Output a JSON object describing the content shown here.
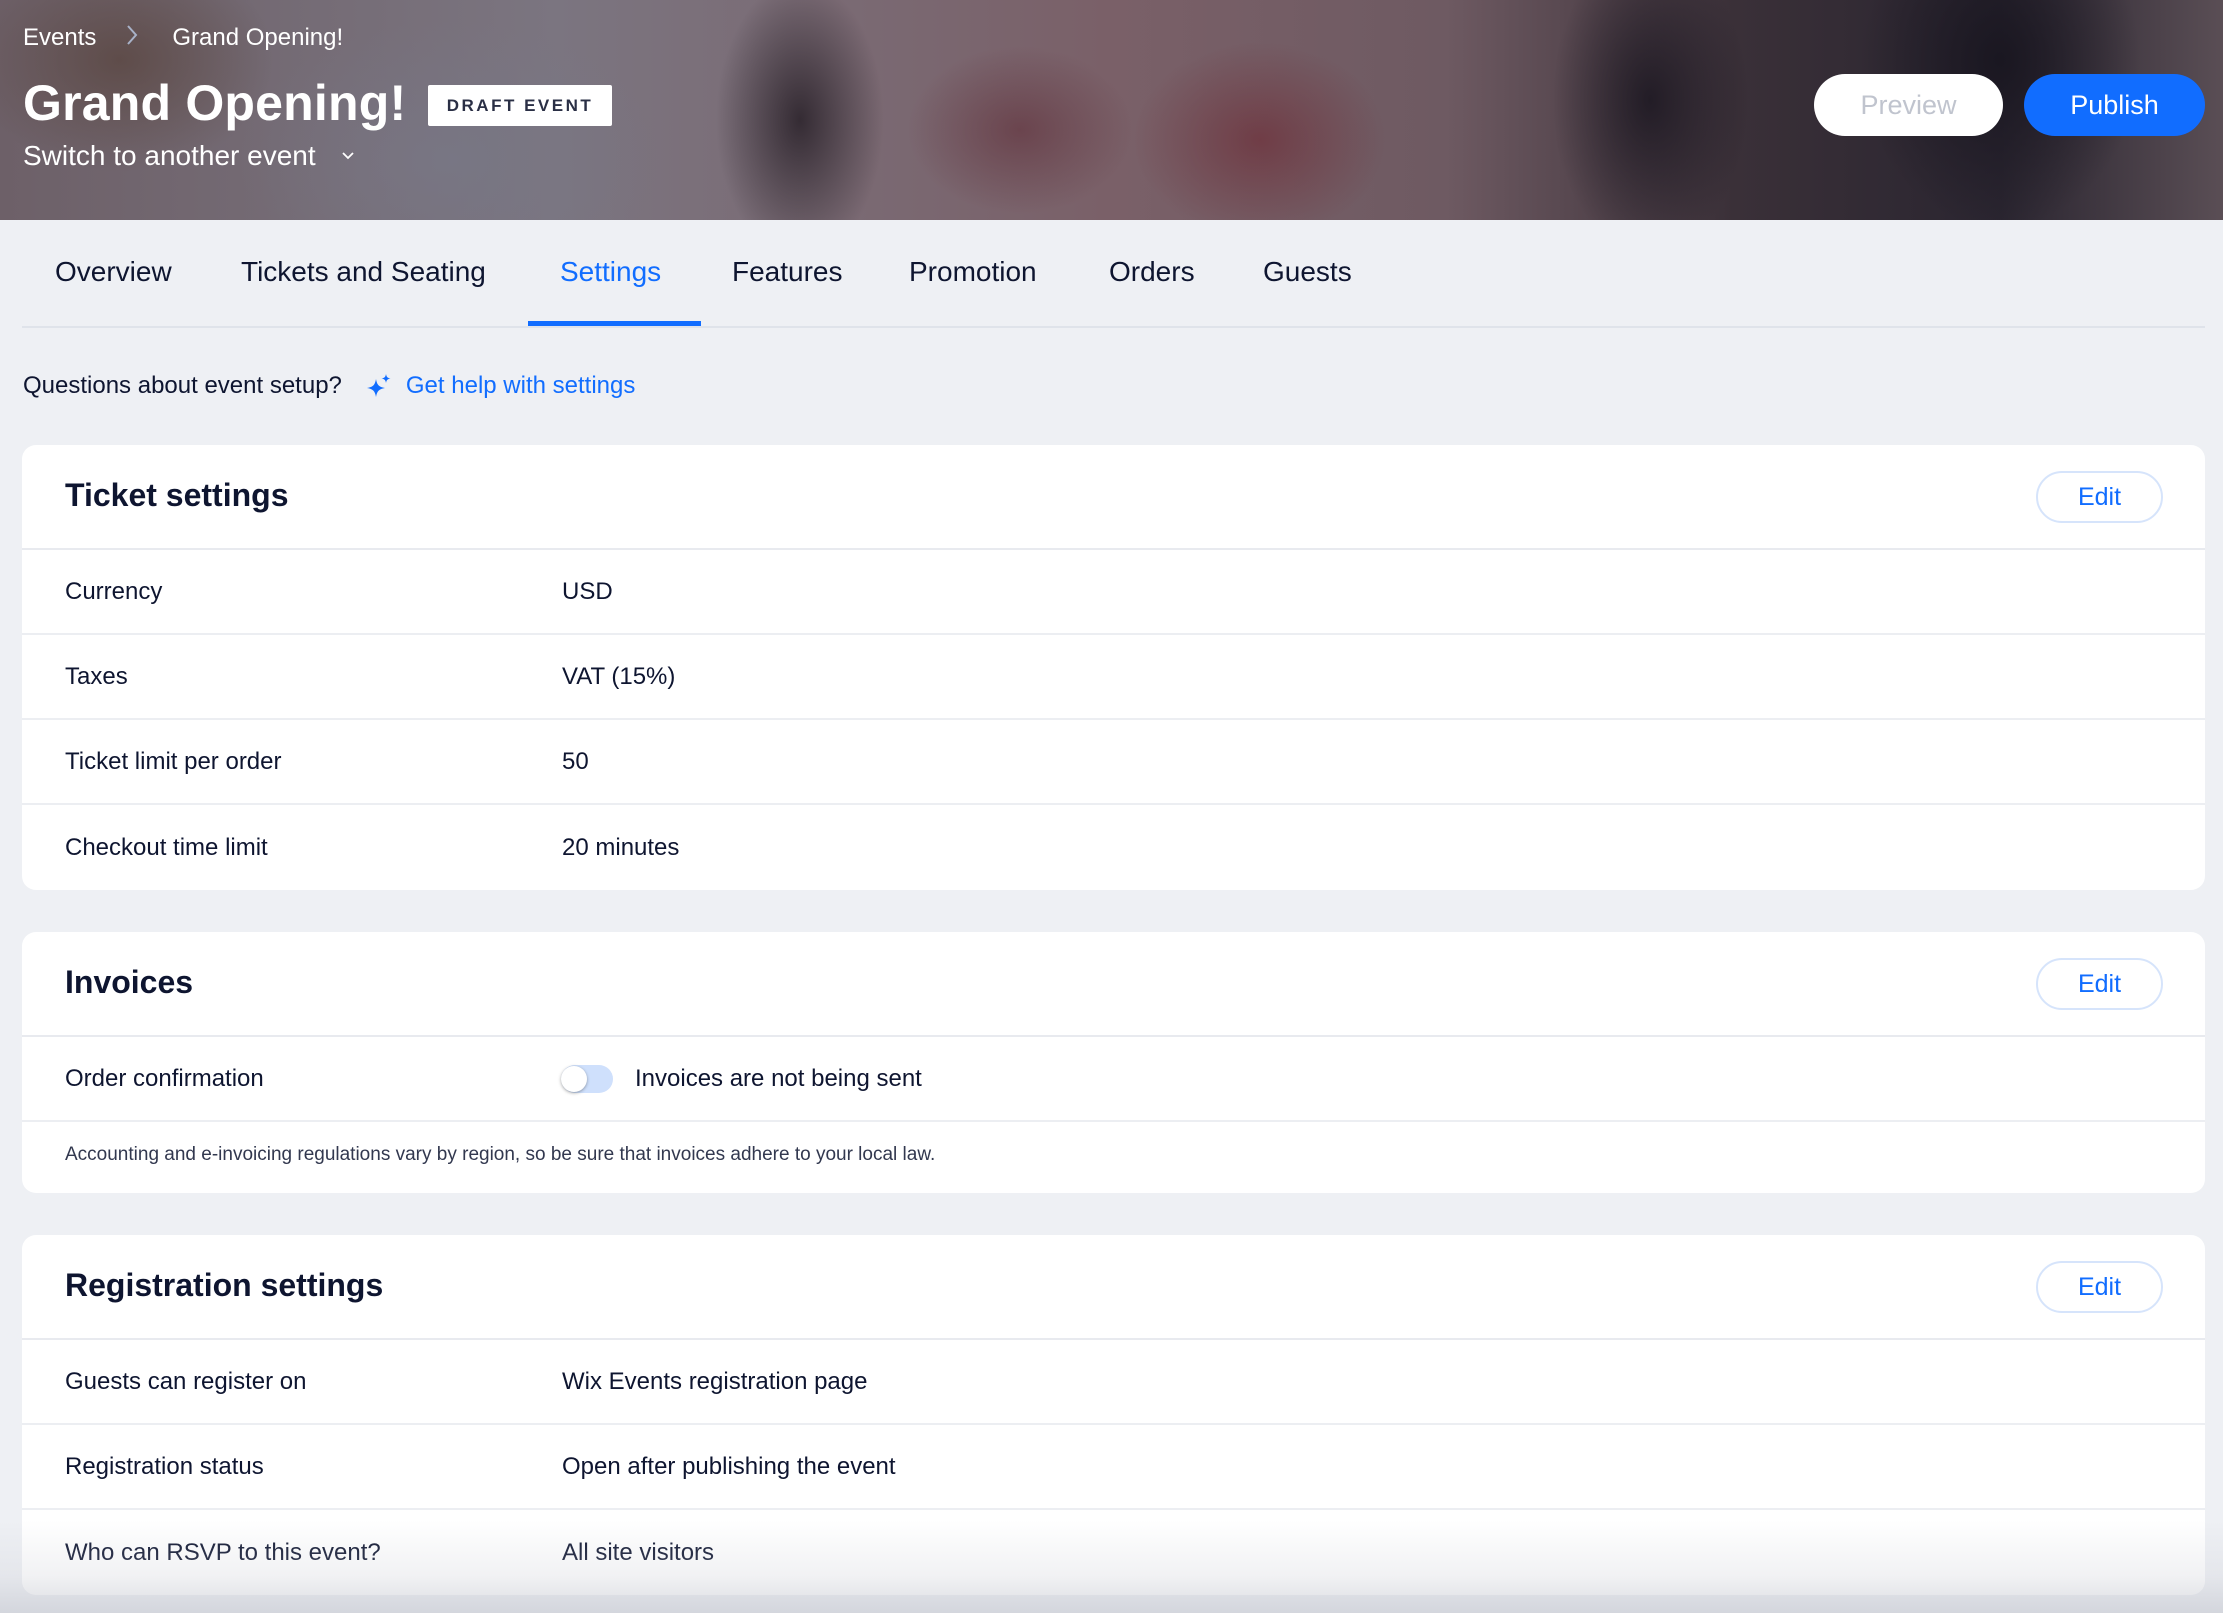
{
  "header": {
    "breadcrumb": [
      {
        "label": "Events"
      },
      {
        "label": "Grand Opening!"
      }
    ],
    "title": "Grand Opening!",
    "status_badge": "DRAFT EVENT",
    "switch_event_label": "Switch to another event",
    "preview_label": "Preview",
    "publish_label": "Publish"
  },
  "tabs": [
    {
      "label": "Overview",
      "active": false
    },
    {
      "label": "Tickets and Seating",
      "active": false
    },
    {
      "label": "Settings",
      "active": true
    },
    {
      "label": "Features",
      "active": false
    },
    {
      "label": "Promotion",
      "active": false
    },
    {
      "label": "Orders",
      "active": false
    },
    {
      "label": "Guests",
      "active": false
    }
  ],
  "help": {
    "question": "Questions about event setup?",
    "link_label": "Get help with settings",
    "icon": "sparkle-icon"
  },
  "ticket_settings": {
    "title": "Ticket settings",
    "edit_label": "Edit",
    "rows": [
      {
        "label": "Currency",
        "value": "USD"
      },
      {
        "label": "Taxes",
        "value": "VAT (15%)"
      },
      {
        "label": "Ticket limit per order",
        "value": "50"
      },
      {
        "label": "Checkout time limit",
        "value": "20 minutes"
      }
    ]
  },
  "invoices": {
    "title": "Invoices",
    "edit_label": "Edit",
    "order_confirmation_label": "Order confirmation",
    "toggle_on": false,
    "toggle_text": "Invoices are not being sent",
    "note": "Accounting and e-invoicing regulations vary by region, so be sure that invoices adhere to your local law."
  },
  "registration_settings": {
    "title": "Registration settings",
    "edit_label": "Edit",
    "rows": [
      {
        "label": "Guests can register on",
        "value": "Wix Events registration page"
      },
      {
        "label": "Registration status",
        "value": "Open after publishing the event"
      },
      {
        "label": "Who can RSVP to this event?",
        "value": "All site visitors"
      }
    ]
  },
  "colors": {
    "accent": "#116dff",
    "text": "#0e1530",
    "page_bg": "#eef0f4",
    "card_bg": "#ffffff",
    "toggle_off_track": "#cfe0fc"
  }
}
